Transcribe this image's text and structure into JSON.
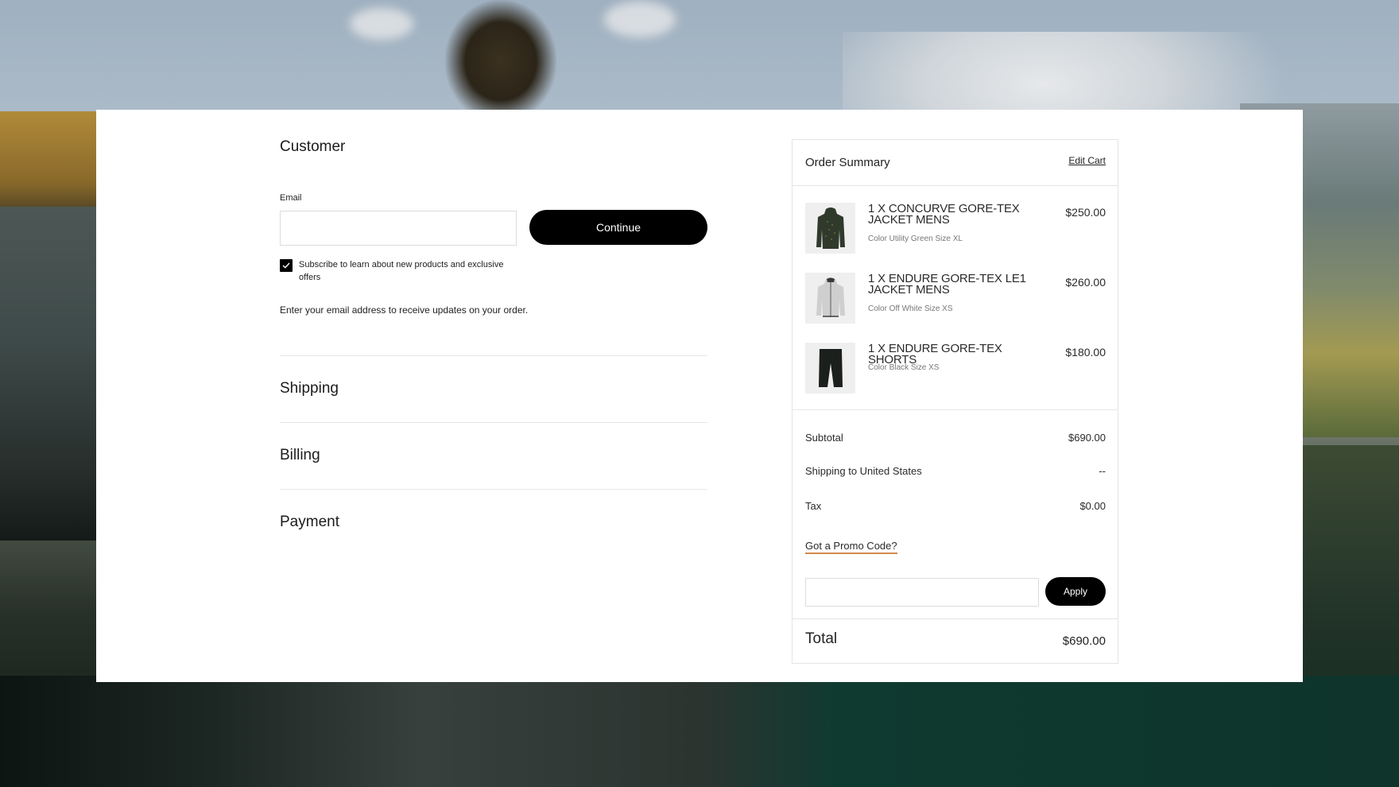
{
  "customer": {
    "title": "Customer",
    "email_label": "Email",
    "email_value": "",
    "email_placeholder": "",
    "continue_label": "Continue",
    "subscribe_checked": true,
    "subscribe_label": "Subscribe to learn about new products and exclusive offers",
    "hint": "Enter your email address to receive updates on your order."
  },
  "sections": {
    "shipping": "Shipping",
    "billing": "Billing",
    "payment": "Payment"
  },
  "order_summary": {
    "title": "Order Summary",
    "edit_cart_label": "Edit Cart",
    "items": [
      {
        "name": "1 X CONCURVE GORE-TEX JACKET MENS",
        "meta": "Color Utility Green  Size XL",
        "price": "$250.00",
        "thumb_icon": "green-jacket-image",
        "thumb_color": "#2f3a2c"
      },
      {
        "name": "1 X ENDURE GORE-TEX LE1 JACKET MENS",
        "meta": "Color Off White  Size XS",
        "price": "$260.00",
        "thumb_icon": "white-jacket-image",
        "thumb_color": "#cfcfcf"
      },
      {
        "name": "1 X ENDURE GORE-TEX SHORTS",
        "meta": "Color Black  Size XS",
        "price": "$180.00",
        "thumb_icon": "black-shorts-image",
        "thumb_color": "#1c201d"
      }
    ],
    "subtotal_label": "Subtotal",
    "subtotal_value": "$690.00",
    "shipping_label": "Shipping to United States",
    "shipping_value": "--",
    "tax_label": "Tax",
    "tax_value": "$0.00",
    "promo_link": "Got a Promo Code?",
    "promo_value": "",
    "promo_placeholder": "",
    "apply_label": "Apply",
    "total_label": "Total",
    "total_value": "$690.00"
  },
  "colors": {
    "primary_button": "#000000",
    "promo_underline": "#d4894a"
  }
}
